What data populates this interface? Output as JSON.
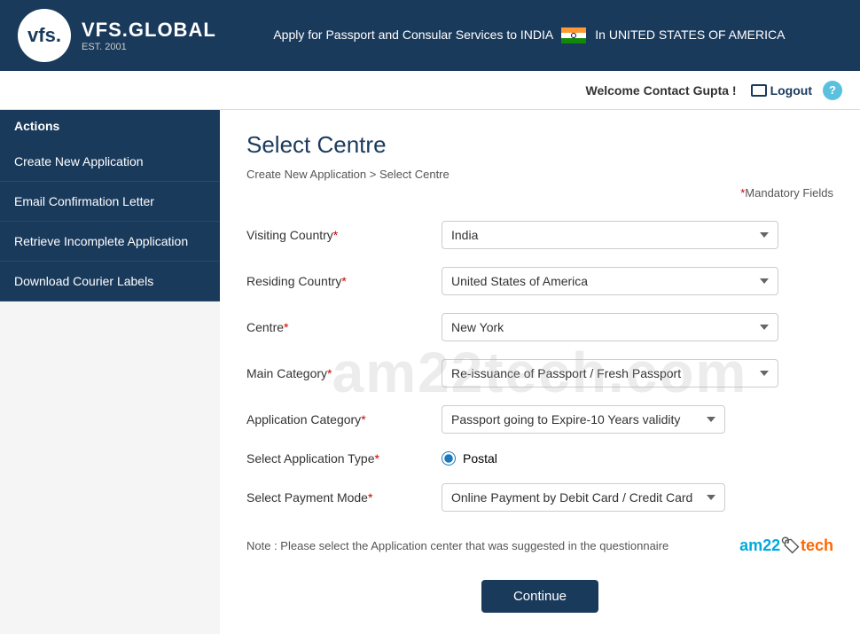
{
  "header": {
    "logo_initials": "vfs.",
    "brand_name": "VFS.GLOBAL",
    "est": "EST. 2001",
    "tagline": "Apply for Passport and Consular Services to INDIA",
    "region": "In UNITED STATES OF AMERICA"
  },
  "subheader": {
    "welcome": "Welcome Contact Gupta !",
    "logout": "Logout",
    "help": "?"
  },
  "sidebar": {
    "title": "Actions",
    "items": [
      {
        "label": "Create New Application"
      },
      {
        "label": "Email Confirmation Letter"
      },
      {
        "label": "Retrieve Incomplete Application"
      },
      {
        "label": "Download Courier Labels"
      }
    ]
  },
  "page": {
    "title": "Select Centre",
    "breadcrumb_part1": "Create New Application",
    "breadcrumb_sep": " > ",
    "breadcrumb_part2": "Select Centre",
    "mandatory_note": "Mandatory Fields"
  },
  "form": {
    "visiting_country_label": "Visiting Country",
    "visiting_country_value": "India",
    "residing_country_label": "Residing Country",
    "residing_country_value": "United States of America",
    "centre_label": "Centre",
    "centre_value": "New York",
    "main_category_label": "Main Category",
    "main_category_value": "Re-issuance of Passport / Fresh Passport",
    "application_category_label": "Application Category",
    "application_category_value": "Passport going to Expire-10 Years validity",
    "application_type_label": "Select Application Type",
    "application_type_value": "Postal",
    "payment_mode_label": "Select Payment Mode",
    "payment_mode_value": "Online Payment by Debit Card / Credit Card",
    "note": "Note : Please select the Application center that was suggested in the questionnaire",
    "continue_btn": "Continue"
  },
  "watermark": "am22tech.com",
  "am22_logo": {
    "text1": "am22",
    "icon": "🏷",
    "text2": "tech"
  }
}
